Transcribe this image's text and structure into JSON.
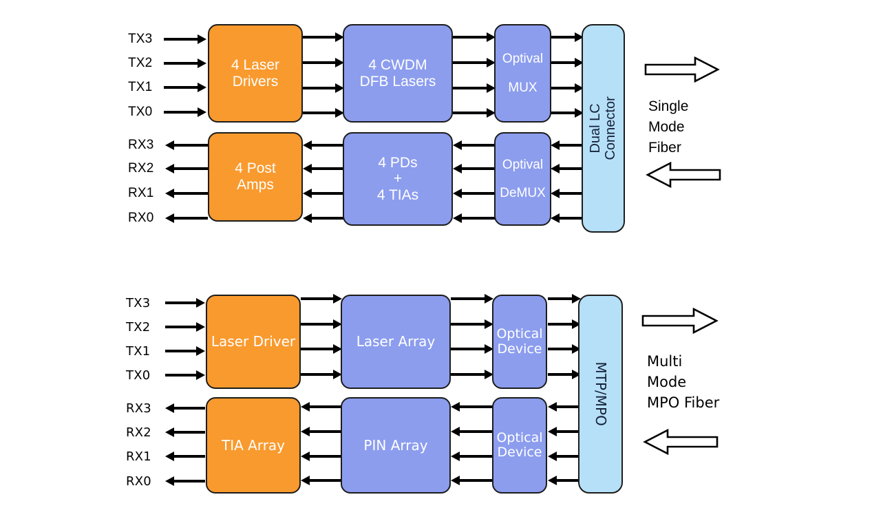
{
  "diagrams": [
    {
      "id": "single-mode-cwdm",
      "tx_ports": [
        "TX3",
        "TX2",
        "TX1",
        "TX0"
      ],
      "rx_ports": [
        "RX3",
        "RX2",
        "RX1",
        "RX0"
      ],
      "tx_blocks": [
        {
          "name": "laser-drivers",
          "label": "4 Laser\nDrivers",
          "color": "#F99A2E"
        },
        {
          "name": "cwdm-dfb-lasers",
          "label": "4 CWDM\nDFB Lasers",
          "color": "#8C9DEE"
        },
        {
          "name": "optical-mux",
          "label_line1": "Optival",
          "label_line2": "MUX",
          "color": "#8C9DEE"
        }
      ],
      "rx_blocks": [
        {
          "name": "post-amps",
          "label": "4 Post\nAmps",
          "color": "#F99A2E"
        },
        {
          "name": "pds-tias",
          "label": "4 PDs\n+\n4 TIAs",
          "color": "#8C9DEE"
        },
        {
          "name": "optical-demux",
          "label_line1": "Optival",
          "label_line2": "DeMUX",
          "color": "#8C9DEE"
        }
      ],
      "connector": {
        "name": "dual-lc-connector",
        "label": "Dual LC\nConnector",
        "color": "#B6E0F7"
      },
      "fiber_caption": "Single\nMode\nFiber",
      "tx_direction": "right",
      "rx_direction": "left"
    },
    {
      "id": "multi-mode-mpo",
      "tx_ports": [
        "TX3",
        "TX2",
        "TX1",
        "TX0"
      ],
      "rx_ports": [
        "RX3",
        "RX2",
        "RX1",
        "RX0"
      ],
      "tx_blocks": [
        {
          "name": "laser-driver",
          "label": "Laser Driver",
          "color": "#F99A2E"
        },
        {
          "name": "laser-array",
          "label": "Laser Array",
          "color": "#8C9DEE"
        },
        {
          "name": "optical-device-tx",
          "label": "Optical\nDevice",
          "color": "#8C9DEE"
        }
      ],
      "rx_blocks": [
        {
          "name": "tia-array",
          "label": "TIA Array",
          "color": "#F99A2E"
        },
        {
          "name": "pin-array",
          "label": "PIN Array",
          "color": "#8C9DEE"
        },
        {
          "name": "optical-device-rx",
          "label": "Optical\nDevice",
          "color": "#8C9DEE"
        }
      ],
      "connector": {
        "name": "mtp-mpo-connector",
        "label": "MTP/MPO",
        "color": "#B6E0F7"
      },
      "fiber_caption": "Multi\nMode\nMPO Fiber",
      "tx_direction": "right",
      "rx_direction": "left"
    }
  ],
  "colors": {
    "orange": "#F99A2E",
    "blue": "#8C9DEE",
    "light_blue": "#B6E0F7",
    "outline": "#1C1C1C",
    "background": "#FFFFFF",
    "label_text": "#000000",
    "block_text": "#FFFFFF"
  },
  "icons": {
    "tx_flow": "arrow-right-icon",
    "rx_flow": "arrow-left-icon",
    "fiber_out": "block-arrow-right-icon",
    "fiber_in": "block-arrow-left-icon"
  }
}
